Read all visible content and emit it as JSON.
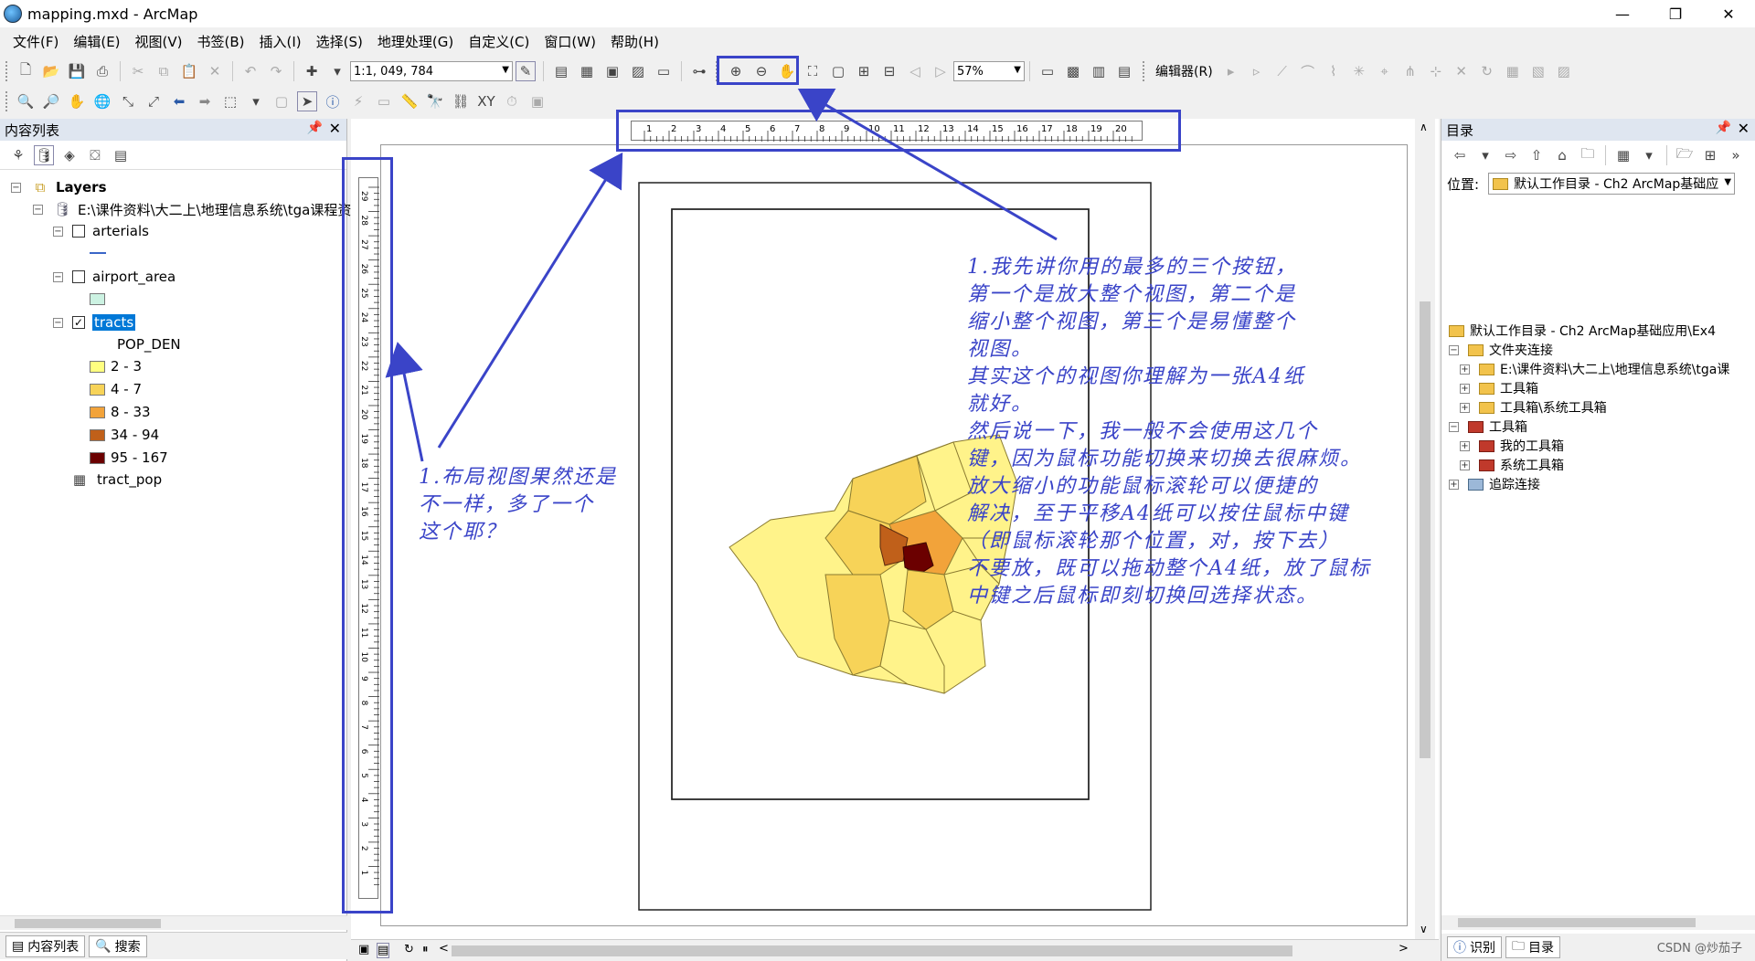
{
  "window": {
    "title": "mapping.mxd - ArcMap",
    "minimize": "—",
    "maximize": "❐",
    "close": "✕"
  },
  "menu": [
    "文件(F)",
    "编辑(E)",
    "视图(V)",
    "书签(B)",
    "插入(I)",
    "选择(S)",
    "地理处理(G)",
    "自定义(C)",
    "窗口(W)",
    "帮助(H)"
  ],
  "toolbar": {
    "scale": "1:1, 049, 784",
    "zoom": "57%",
    "editor": "编辑器(R)"
  },
  "toc": {
    "title": "内容列表",
    "root": "Layers",
    "datasource": "E:\\课件资料\\大二上\\地理信息系统\\tga课程资",
    "layers": [
      {
        "name": "arterials",
        "checked": false
      },
      {
        "name": "airport_area",
        "checked": false
      },
      {
        "name": "tracts",
        "checked": true
      }
    ],
    "field": "POP_DEN",
    "classes": [
      {
        "label": "2 - 3",
        "color": "#ffff80"
      },
      {
        "label": "4 - 7",
        "color": "#f7d358"
      },
      {
        "label": "8 - 33",
        "color": "#f2a33a"
      },
      {
        "label": "34 - 94",
        "color": "#c0601a"
      },
      {
        "label": "95 - 167",
        "color": "#6b0000"
      }
    ],
    "table": "tract_pop",
    "tabs": [
      "内容列表",
      "搜索"
    ]
  },
  "catalog": {
    "title": "目录",
    "location_label": "位置:",
    "location_value": "默认工作目录 - Ch2 ArcMap基础应",
    "items": [
      "默认工作目录 - Ch2  ArcMap基础应用\\Ex4",
      "文件夹连接",
      "E:\\课件资料\\大二上\\地理信息系统\\tga课",
      "工具箱",
      "工具箱\\系统工具箱",
      "工具箱",
      "我的工具箱",
      "系统工具箱",
      "追踪连接"
    ],
    "tabs": [
      "识别",
      "目录"
    ]
  },
  "ruler": {
    "h_labels": [
      "1",
      "2",
      "3",
      "4",
      "5",
      "6",
      "7",
      "8",
      "9",
      "10",
      "11",
      "12",
      "13",
      "14",
      "15",
      "16",
      "17",
      "18",
      "19",
      "20"
    ],
    "v_labels": [
      "29",
      "28",
      "27",
      "26",
      "25",
      "24",
      "23",
      "22",
      "21",
      "20",
      "19",
      "18",
      "17",
      "16",
      "15",
      "14",
      "13",
      "12",
      "11",
      "10",
      "9",
      "8",
      "7",
      "6",
      "5",
      "4",
      "3",
      "2",
      "1"
    ]
  },
  "annotations": {
    "left_note": "1.布局视图果然还是\n不一样，多了一个\n这个耶？",
    "right_note": "1.我先讲你用的最多的三个按钮，\n第一个是放大整个视图，第二个是\n缩小整个视图，第三个是易懂整个\n视图。\n其实这个的视图你理解为一张A4纸\n就好。\n然后说一下，我一般不会使用这几个\n键，因为鼠标功能切换来切换去很麻烦。\n放大缩小的功能鼠标滚轮可以便捷的\n解决，至于平移A4纸可以按住鼠标中键\n（即鼠标滚轮那个位置，对，按下去）\n不要放，既可以拖动整个A4纸，放了鼠标\n中键之后鼠标即刻切换回选择状态。",
    "color": "#3a44c8"
  },
  "watermark": "CSDN @炒茄子"
}
